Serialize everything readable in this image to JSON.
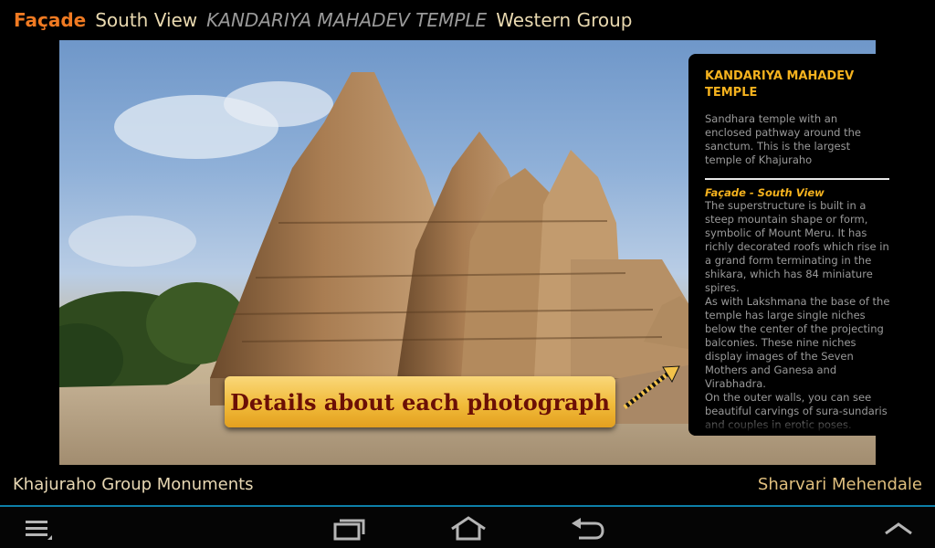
{
  "header": {
    "facade": "Façade",
    "view": "South View",
    "temple": "KANDARIYA MAHADEV TEMPLE",
    "group": "Western Group"
  },
  "callout": {
    "text": "Details about each photograph"
  },
  "info_panel": {
    "title": "KANDARIYA MAHADEV TEMPLE",
    "summary": "Sandhara temple with an enclosed pathway around the sanctum. This is the largest temple of Khajuraho",
    "subtitle": "Façade - South View",
    "body_1": "The superstructure is built in a steep mountain shape or form, symbolic of Mount Meru. It has richly decorated roofs which rise in a grand form terminating in the shikara, which has 84 miniature spires.",
    "body_2": "As with Lakshmana the base of the temple has large single niches below the center of the projecting balconies. These nine niches display images of the Seven Mothers and Ganesa and Virabhadra.",
    "body_3": "On the outer walls, you can see beautiful carvings of sura-sundaris and couples in erotic poses."
  },
  "footer": {
    "app_name": "Khajuraho Group Monuments",
    "author": "Sharvari Mehendale"
  },
  "nav_bar": {
    "icons": [
      "menu-icon",
      "recent-apps-icon",
      "home-icon",
      "back-icon",
      "chevron-up-icon"
    ]
  },
  "colors": {
    "accent_orange": "#f07a22",
    "panel_title": "#f5b21e",
    "callout_text": "#6b0f06",
    "nav_line": "#0d7fa8"
  }
}
